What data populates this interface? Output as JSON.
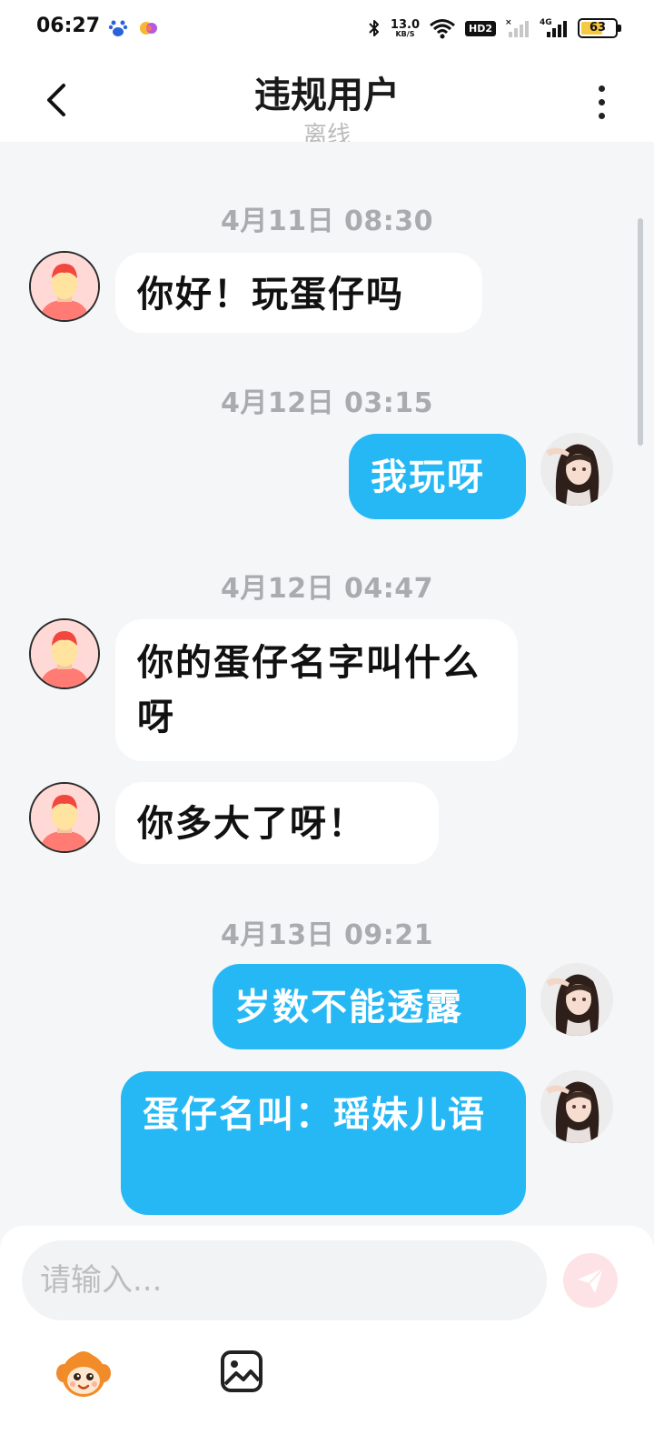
{
  "status_bar": {
    "time": "06:27",
    "net_speed_value": "13.0",
    "net_speed_unit": "KB/S",
    "hd_label": "HD2",
    "network_label": "4G",
    "battery_level": "63",
    "battery_color": "#f6c944"
  },
  "header": {
    "title": "违规用户",
    "subtitle": "离线",
    "back_icon": "chevron-left-icon",
    "more_icon": "more-vertical-icon"
  },
  "messages": [
    {
      "type": "timestamp",
      "text": "4月11日 08:30"
    },
    {
      "type": "received",
      "text": "你好！玩蛋仔吗"
    },
    {
      "type": "timestamp",
      "text": "4月12日 03:15"
    },
    {
      "type": "sent",
      "text": "我玩呀"
    },
    {
      "type": "timestamp",
      "text": "4月12日 04:47"
    },
    {
      "type": "received",
      "text": "你的蛋仔名字叫什么呀"
    },
    {
      "type": "received",
      "text": "你多大了呀！"
    },
    {
      "type": "timestamp",
      "text": "4月13日 09:21"
    },
    {
      "type": "sent",
      "text": "岁数不能透露"
    },
    {
      "type": "sent",
      "text": "蛋仔名叫：瑶妹儿语"
    }
  ],
  "input": {
    "placeholder": "请输入...",
    "value": "",
    "send_icon": "send-icon"
  },
  "toolbar": {
    "mascot_icon": "mascot-icon",
    "image_icon": "image-icon"
  },
  "colors": {
    "sent_bubble": "#25b8f5",
    "received_bubble": "#ffffff",
    "background": "#f4f6f8",
    "timestamp": "#a9abae"
  }
}
